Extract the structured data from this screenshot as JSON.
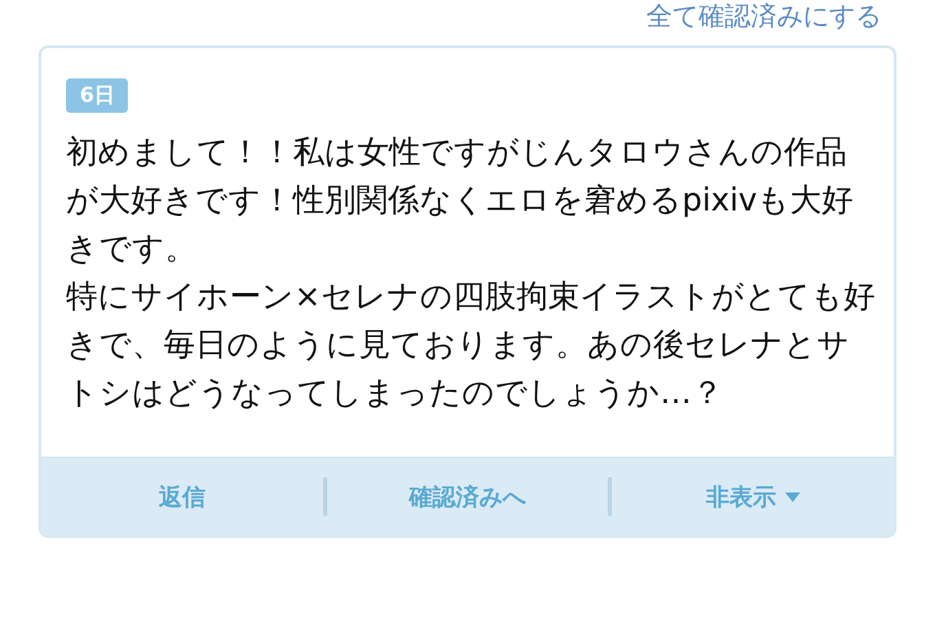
{
  "header_link": "全て確認済みにする",
  "message": {
    "date_badge": "6日",
    "paragraphs": [
      "初めまして！！私は女性ですがじんタロウさんの作品が大好きです！性別関係なくエロを窘めるpixivも大好きです。",
      "特にサイホーン×セレナの四肢拘束イラストがとても好きで、毎日のように見ております。あの後セレナとサトシはどうなってしまったのでしょうか…？"
    ]
  },
  "actions": [
    {
      "label": "返信",
      "kind": "plain"
    },
    {
      "label": "確認済みへ",
      "kind": "plain"
    },
    {
      "label": "非表示",
      "kind": "dropdown"
    }
  ]
}
